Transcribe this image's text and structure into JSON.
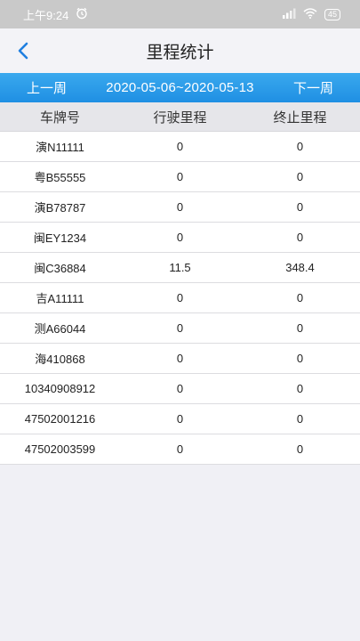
{
  "status": {
    "time": "上午9:24",
    "battery": "45"
  },
  "header": {
    "title": "里程统计"
  },
  "week": {
    "prev": "上一周",
    "range": "2020-05-06~2020-05-13",
    "next": "下一周"
  },
  "table": {
    "columns": [
      "车牌号",
      "行驶里程",
      "终止里程"
    ],
    "rows": [
      {
        "plate": "演N11111",
        "driven": "0",
        "end": "0"
      },
      {
        "plate": "粤B55555",
        "driven": "0",
        "end": "0"
      },
      {
        "plate": "演B78787",
        "driven": "0",
        "end": "0"
      },
      {
        "plate": "闽EY1234",
        "driven": "0",
        "end": "0"
      },
      {
        "plate": "闽C36884",
        "driven": "11.5",
        "end": "348.4"
      },
      {
        "plate": "吉A11111",
        "driven": "0",
        "end": "0"
      },
      {
        "plate": "测A66044",
        "driven": "0",
        "end": "0"
      },
      {
        "plate": "海410868",
        "driven": "0",
        "end": "0"
      },
      {
        "plate": "10340908912",
        "driven": "0",
        "end": "0"
      },
      {
        "plate": "47502001216",
        "driven": "0",
        "end": "0"
      },
      {
        "plate": "47502003599",
        "driven": "0",
        "end": "0"
      }
    ]
  },
  "colors": {
    "accent": "#1f8fe3",
    "back_arrow": "#1f7fe0"
  }
}
